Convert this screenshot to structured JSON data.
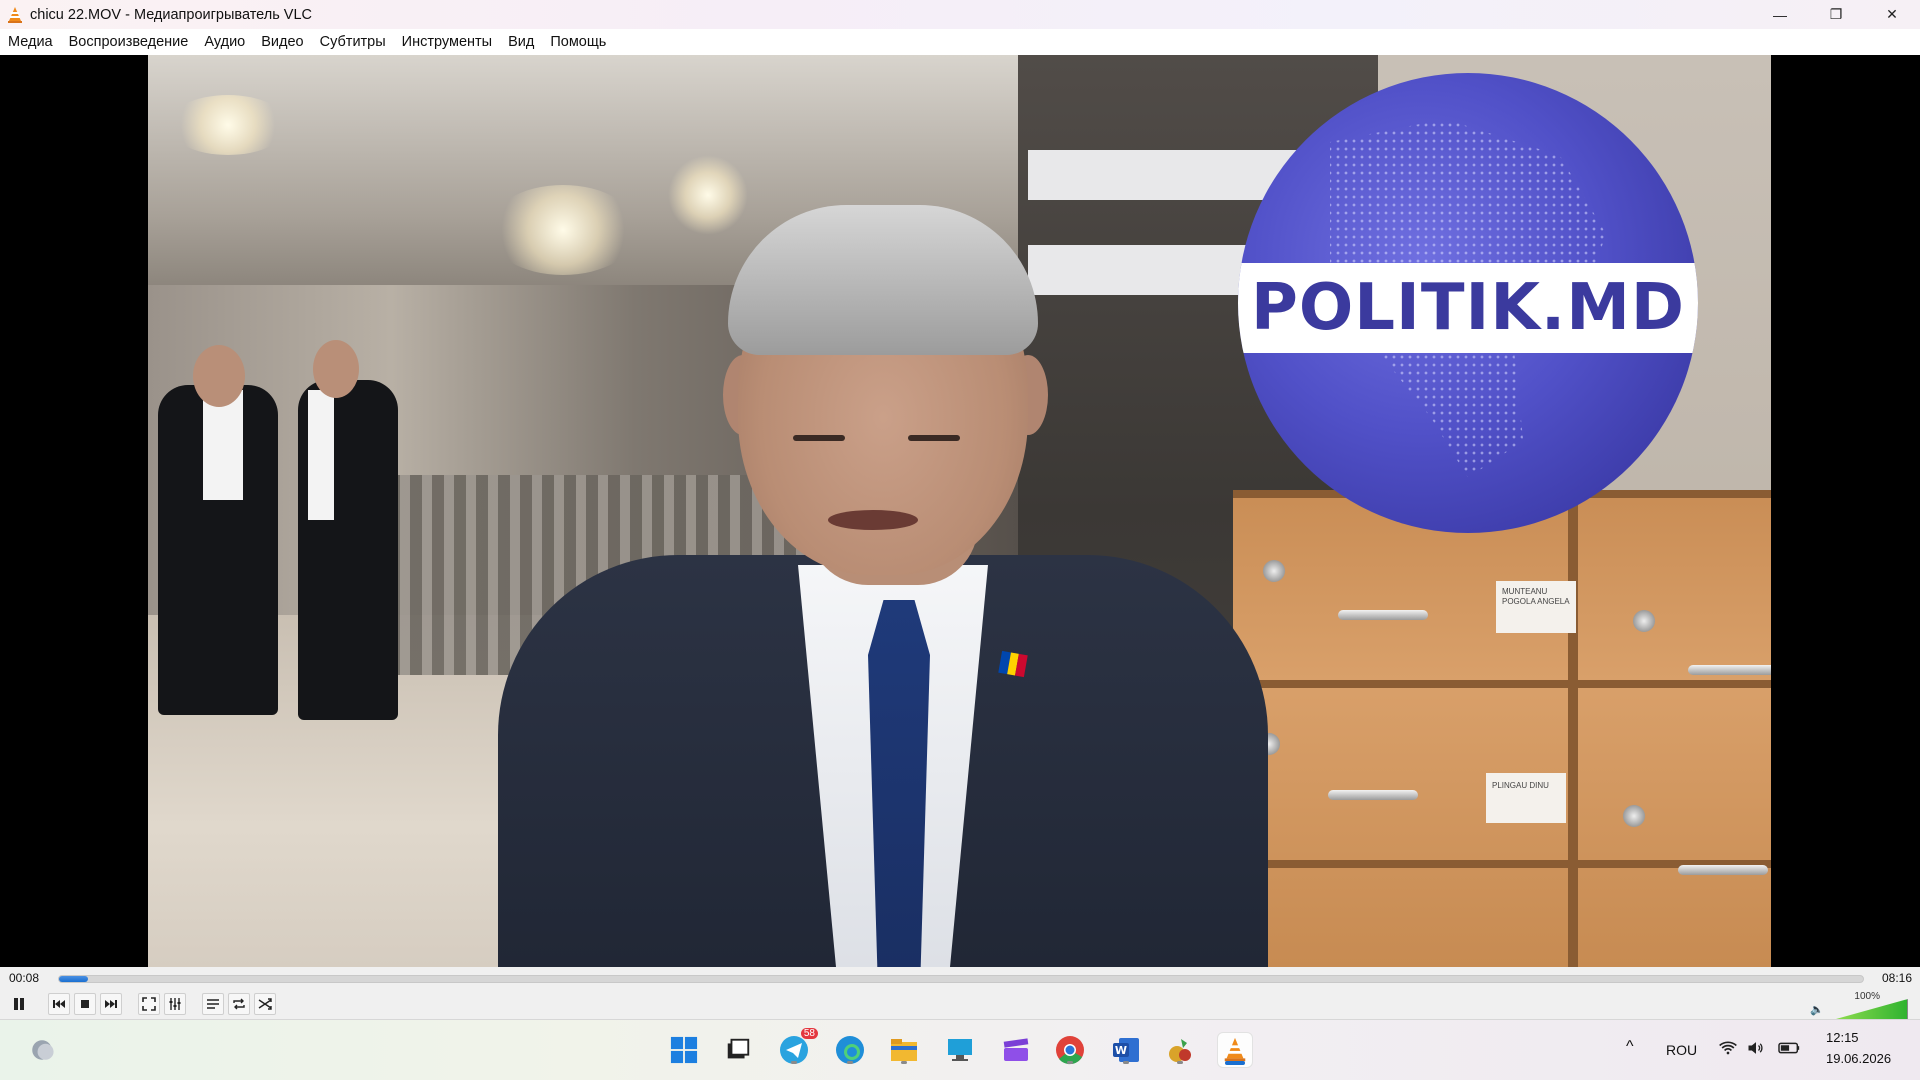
{
  "window": {
    "title": "chicu 22.MOV - Медиапроигрыватель VLC",
    "minimize_glyph": "—",
    "restore_glyph": "❐",
    "close_glyph": "✕"
  },
  "menu": {
    "items": [
      "Медиа",
      "Воспроизведение",
      "Аудио",
      "Видео",
      "Субтитры",
      "Инструменты",
      "Вид",
      "Помощь"
    ]
  },
  "video": {
    "logo_text": "POLITIK.MD",
    "label_1": "MUNTEANU POGOLA ANGELA",
    "label_2": "PLINGAU DINU"
  },
  "playback": {
    "current_time": "00:08",
    "total_time": "08:16",
    "progress_fraction": 0.016,
    "volume_percent": "100%",
    "state": "playing"
  },
  "controls": {
    "icons": [
      "pause-icon",
      "previous-icon",
      "stop-icon",
      "next-icon",
      "fullscreen-icon",
      "extended-settings-icon",
      "playlist-icon",
      "loop-icon",
      "shuffle-icon"
    ]
  },
  "taskbar": {
    "telegram_badge": "58",
    "language": "ROU",
    "clock_time": "12:15",
    "clock_date": "19.06.2026",
    "chevron_glyph": "^",
    "apps": [
      "start-icon",
      "task-view-icon",
      "telegram-icon",
      "edge-icon",
      "file-explorer-icon",
      "remote-desktop-icon",
      "clipchamp-icon",
      "chrome-icon",
      "word-icon",
      "snipping-tool-icon",
      "vlc-icon"
    ]
  },
  "colors": {
    "accent": "#1a6fd0",
    "logo_blue": "#3b3a9e",
    "vlc_orange": "#f08a1a"
  }
}
